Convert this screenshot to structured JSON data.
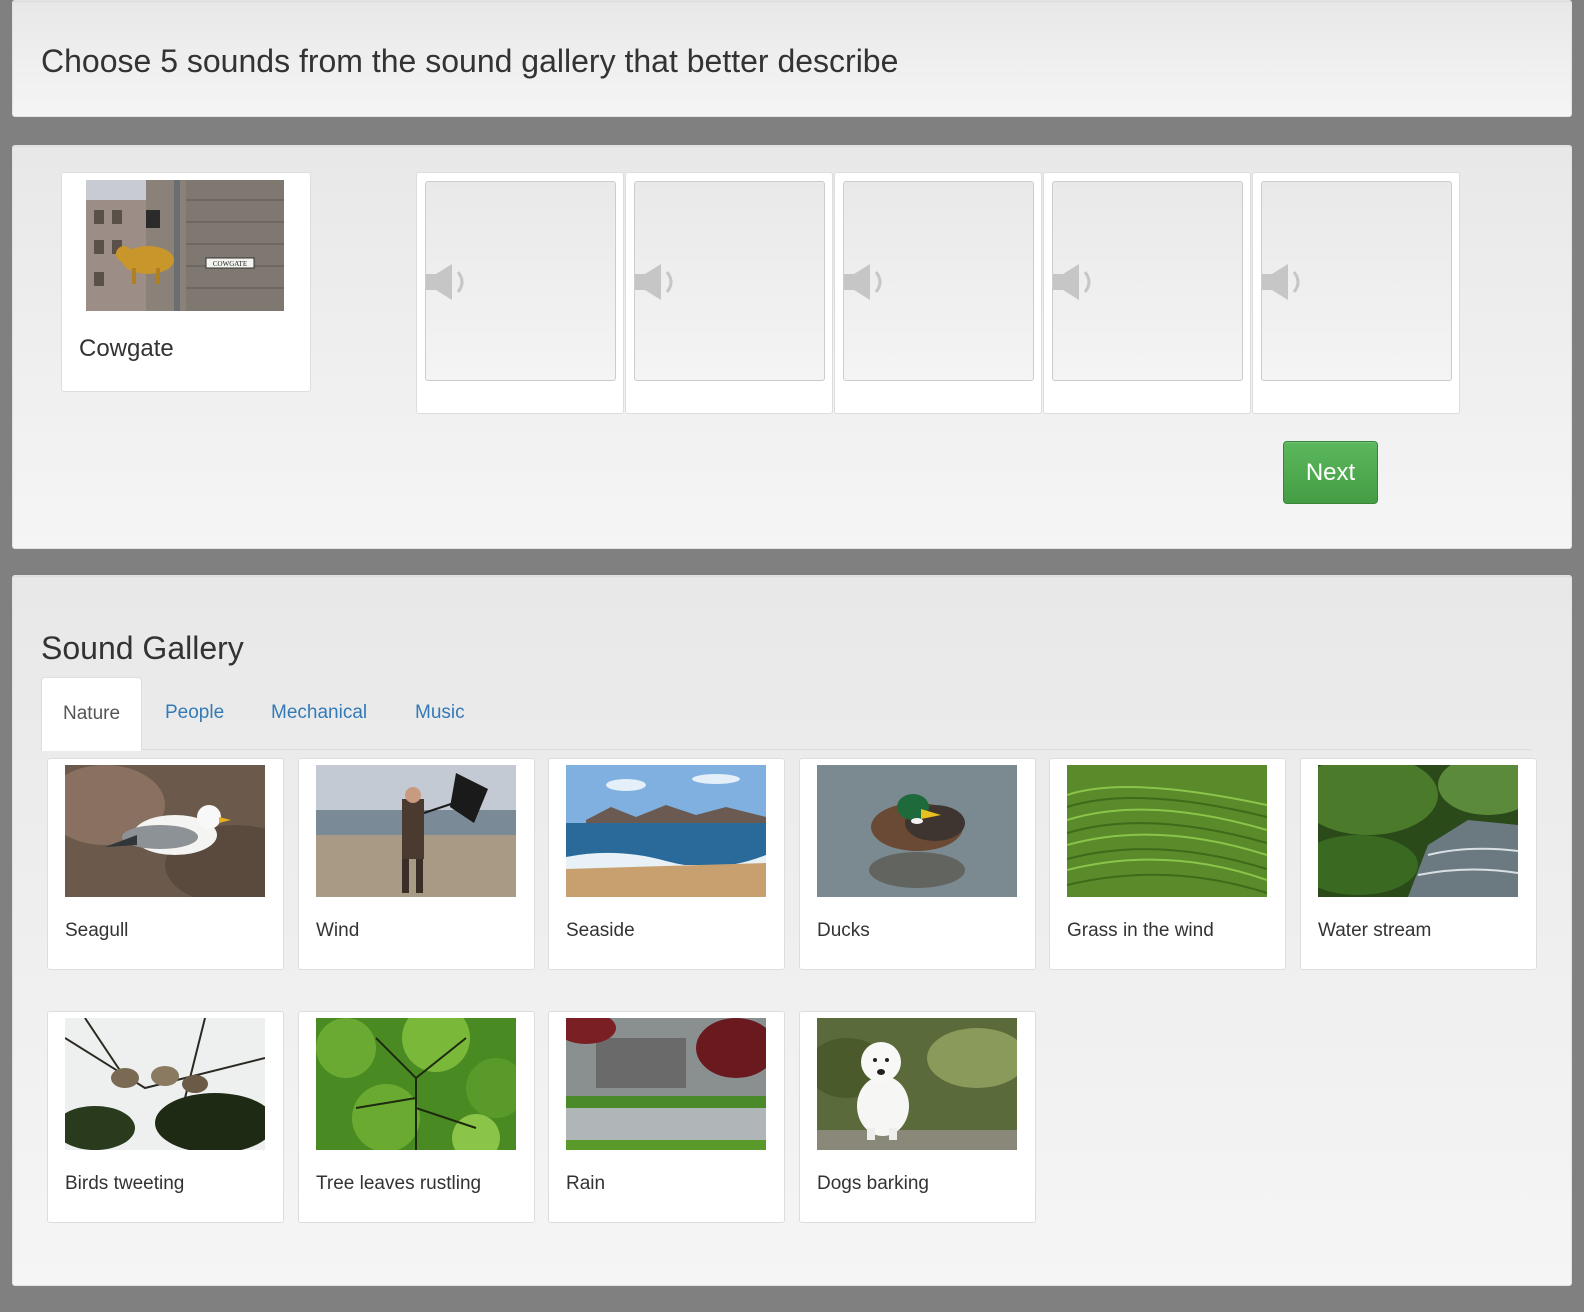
{
  "header": {
    "title": "Choose 5 sounds from the sound gallery that better describe"
  },
  "location": {
    "name": "Cowgate",
    "sign_text": "COWGATE"
  },
  "slots": [
    {
      "icon": "speaker-icon"
    },
    {
      "icon": "speaker-icon"
    },
    {
      "icon": "speaker-icon"
    },
    {
      "icon": "speaker-icon"
    },
    {
      "icon": "speaker-icon"
    }
  ],
  "next_label": "Next",
  "gallery": {
    "title": "Sound Gallery",
    "tabs": [
      {
        "label": "Nature",
        "active": true
      },
      {
        "label": "People",
        "active": false
      },
      {
        "label": "Mechanical",
        "active": false
      },
      {
        "label": "Music",
        "active": false
      }
    ],
    "items": [
      {
        "label": "Seagull"
      },
      {
        "label": "Wind"
      },
      {
        "label": "Seaside"
      },
      {
        "label": "Ducks"
      },
      {
        "label": "Grass in the wind"
      },
      {
        "label": "Water stream"
      },
      {
        "label": "Birds tweeting"
      },
      {
        "label": "Tree leaves rustling"
      },
      {
        "label": "Rain"
      },
      {
        "label": "Dogs barking"
      }
    ]
  },
  "colors": {
    "page_background": "#808080",
    "accent_button": "#5cb85c",
    "tab_link": "#337ab7"
  }
}
